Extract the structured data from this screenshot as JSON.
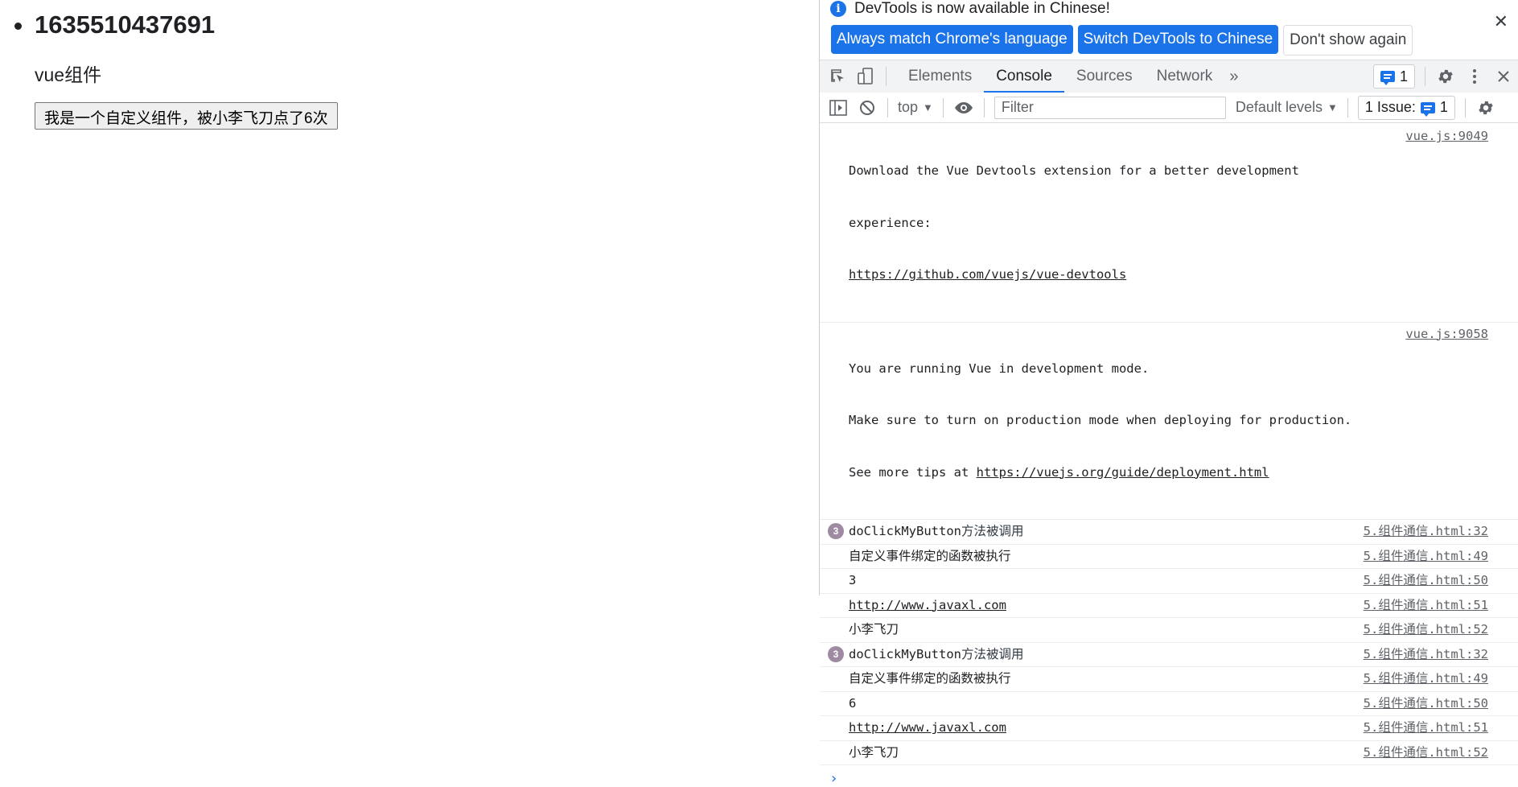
{
  "page": {
    "list_item": "1635510437691",
    "component_title": "vue组件",
    "component_button": "我是一个自定义组件，被小李飞刀点了6次"
  },
  "devtools": {
    "infobar": {
      "message": "DevTools is now available in Chinese!",
      "btn_match": "Always match Chrome's language",
      "btn_switch": "Switch DevTools to Chinese",
      "btn_dismiss": "Don't show again"
    },
    "tabs": [
      "Elements",
      "Console",
      "Sources",
      "Network"
    ],
    "active_tab": "Console",
    "issue_count": "1",
    "filterbar": {
      "context": "top",
      "filter_placeholder": "Filter",
      "levels": "Default levels",
      "issues_label": "1 Issue:",
      "issues_count": "1"
    },
    "console": [
      {
        "badge": "",
        "msg_line1": "Download the Vue Devtools extension for a better development",
        "msg_line2": "experience:",
        "link": "https://github.com/vuejs/vue-devtools",
        "src": "vue.js:9049"
      },
      {
        "badge": "",
        "msg_line1": "You are running Vue in development mode.",
        "msg_line2": "Make sure to turn on production mode when deploying for production.",
        "msg_line3": "See more tips at ",
        "link": "https://vuejs.org/guide/deployment.html",
        "src": "vue.js:9058"
      },
      {
        "badge": "3",
        "msg_a": "doClickMyButton",
        "msg_b": "方法被调用",
        "src": "5.组件通信.html:32"
      },
      {
        "badge": "",
        "msg": "自定义事件绑定的函数被执行",
        "src": "5.组件通信.html:49"
      },
      {
        "badge": "",
        "msg": "3",
        "src": "5.组件通信.html:50"
      },
      {
        "badge": "",
        "msg": "http://www.javaxl.com",
        "src": "5.组件通信.html:51"
      },
      {
        "badge": "",
        "msg": "小李飞刀",
        "src": "5.组件通信.html:52"
      },
      {
        "badge": "3",
        "msg_a": "doClickMyButton",
        "msg_b": "方法被调用",
        "src": "5.组件通信.html:32"
      },
      {
        "badge": "",
        "msg": "自定义事件绑定的函数被执行",
        "src": "5.组件通信.html:49"
      },
      {
        "badge": "",
        "msg": "6",
        "src": "5.组件通信.html:50"
      },
      {
        "badge": "",
        "msg": "http://www.javaxl.com",
        "src": "5.组件通信.html:51"
      },
      {
        "badge": "",
        "msg": "小李飞刀",
        "src": "5.组件通信.html:52"
      }
    ],
    "prompt": "›"
  },
  "colors": {
    "accent": "#1a73e8",
    "badge": "#9e8ba2",
    "number": "#1a1aa6"
  }
}
